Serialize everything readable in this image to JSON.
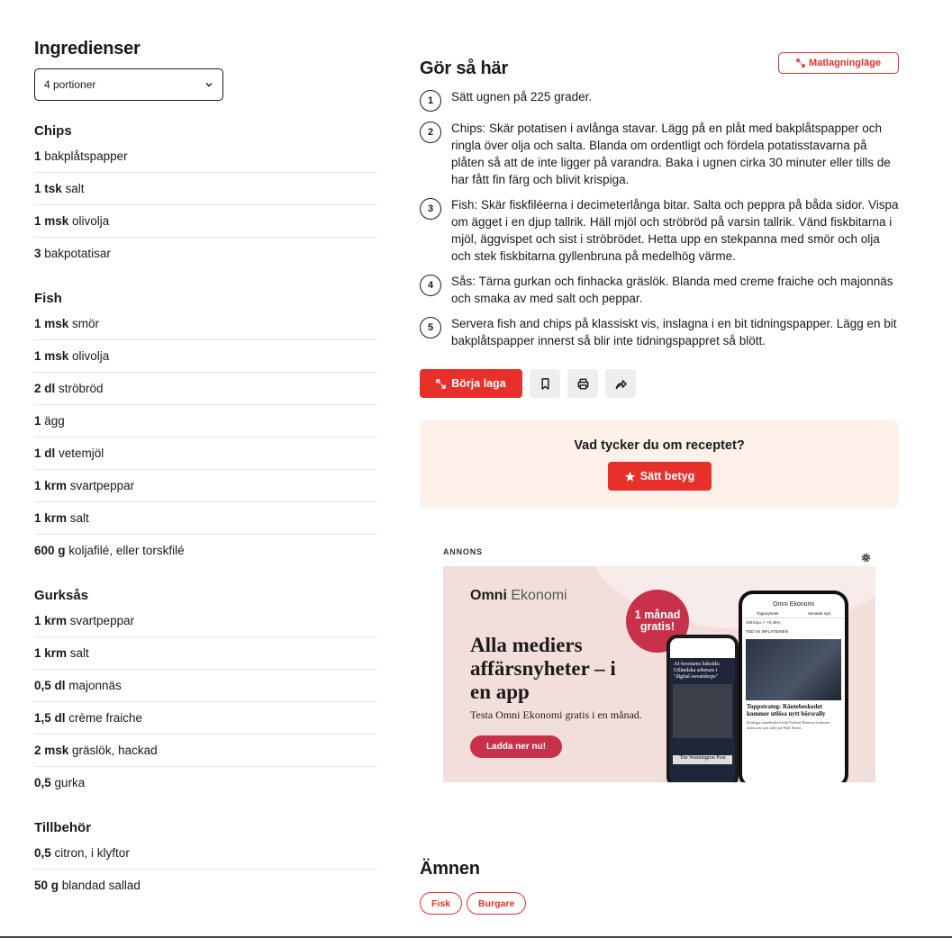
{
  "ingredients": {
    "title": "Ingredienser",
    "portions_selected": "4 portioner",
    "groups": [
      {
        "name": "Chips",
        "items": [
          {
            "qty": "1",
            "name": "bakplåtspapper"
          },
          {
            "qty": "1 tsk",
            "name": "salt"
          },
          {
            "qty": "1 msk",
            "name": "olivolja"
          },
          {
            "qty": "3",
            "name": "bakpotatisar"
          }
        ]
      },
      {
        "name": "Fish",
        "items": [
          {
            "qty": "1 msk",
            "name": "smör"
          },
          {
            "qty": "1 msk",
            "name": "olivolja"
          },
          {
            "qty": "2 dl",
            "name": "ströbröd"
          },
          {
            "qty": "1",
            "name": "ägg"
          },
          {
            "qty": "1 dl",
            "name": "vetemjöl"
          },
          {
            "qty": "1 krm",
            "name": "svartpeppar"
          },
          {
            "qty": "1 krm",
            "name": "salt"
          },
          {
            "qty": "600 g",
            "name": "koljafilé, eller torskfilé"
          }
        ]
      },
      {
        "name": "Gurksås",
        "items": [
          {
            "qty": "1 krm",
            "name": "svartpeppar"
          },
          {
            "qty": "1 krm",
            "name": "salt"
          },
          {
            "qty": "0,5 dl",
            "name": "majonnäs"
          },
          {
            "qty": "1,5 dl",
            "name": "crème fraiche"
          },
          {
            "qty": "2 msk",
            "name": "gräslök, hackad"
          },
          {
            "qty": "0,5",
            "name": "gurka"
          }
        ]
      },
      {
        "name": "Tillbehör",
        "items": [
          {
            "qty": "0,5",
            "name": "citron, i klyftor"
          },
          {
            "qty": "50 g",
            "name": "blandad sallad"
          }
        ]
      }
    ]
  },
  "instructions": {
    "title": "Gör så här",
    "cook_mode_label": "Matlagningläge",
    "steps": [
      {
        "num": "1",
        "text": "Sätt ugnen på 225 grader."
      },
      {
        "num": "2",
        "text": "Chips: Skär potatisen i avlånga stavar. Lägg på en plåt med bakplåtspapper och ringla över olja och salta. Blanda om ordentligt och fördela potatisstavarna på plåten så att de inte ligger på varandra. Baka i ugnen cirka 30 minuter eller tills de har fått fin färg och blivit krispiga."
      },
      {
        "num": "3",
        "text": "Fish: Skär fiskfiléerna i decimeterlånga bitar. Salta och peppra på båda sidor. Vispa om ägget i en djup tallrik. Häll mjöl och ströbröd på varsin tallrik. Vänd fiskbitarna i mjöl, äggvispet och sist i ströbrödet. Hetta upp en stekpanna med smör och olja och stek fiskbitarna gyllenbruna på medelhög värme."
      },
      {
        "num": "4",
        "text": "Sås: Tärna gurkan och finhacka gräslök. Blanda med creme fraiche och majonnäs och smaka av med salt och peppar."
      },
      {
        "num": "5",
        "text": "Servera fish and chips på klassiskt vis, inslagna i en bit tidningspapper. Lägg en bit bakplåtspapper innerst så blir inte tidningspappret så blött."
      }
    ],
    "start_label": "Börja laga"
  },
  "rating": {
    "question": "Vad tycker du om receptet?",
    "button_label": "Sätt betyg"
  },
  "ad": {
    "label": "ANNONS",
    "brand_bold": "Omni",
    "brand_light": "Ekonomi",
    "headline": "Alla mediers affärsnyheter – i en app",
    "subtext": "Testa Omni Ekonomi gratis i en månad.",
    "cta": "Ladda ner nu!",
    "badge": "1 månad gratis!",
    "phone_front": {
      "brand": "Omni Ekonomi",
      "tab1": "Toppnyheter",
      "tab2": "Senaste nytt",
      "ticker": "OMXSpi ↗ +0,35%",
      "news_tag": "FED VS INFLATIONEN",
      "headline": "Toppstrateg: Räntebeskedet kommer utlösa nytt börsrally",
      "body": "Kräftiga räntebesked från Federal Reserve kommer utlösa ett nytt rally på Wall Street."
    },
    "phone_back": {
      "headline": "AI-boomens baksida: Utländska arbetare i \"digital sweatshops\"",
      "paper": "The Washington Post"
    }
  },
  "topics": {
    "title": "Ämnen",
    "tags": [
      "Fisk",
      "Burgare"
    ]
  },
  "colors": {
    "accent": "#e8302a",
    "rating_bg": "#fdf1ea",
    "ad_bg": "#f2dfdb",
    "ad_accent": "#c8314a"
  }
}
